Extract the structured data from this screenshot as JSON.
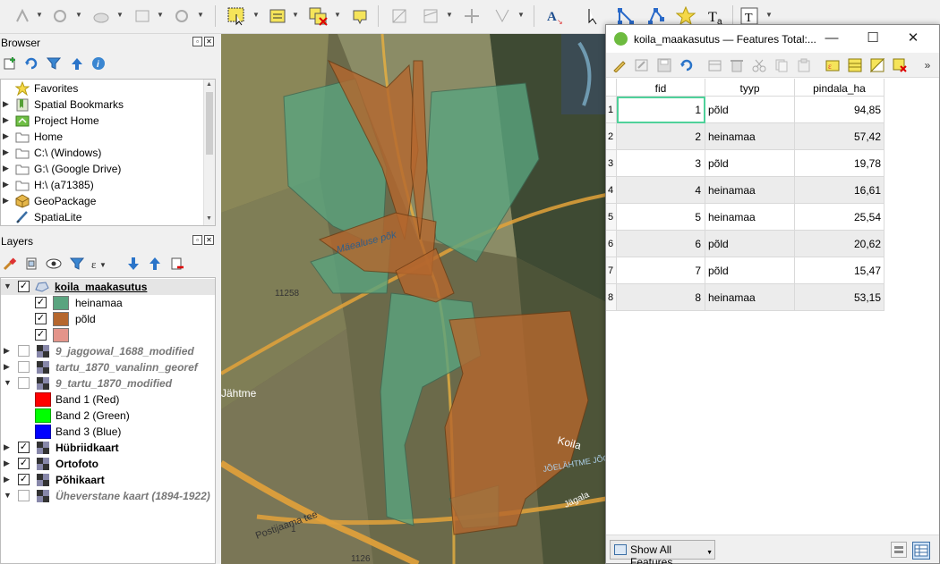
{
  "browser": {
    "title": "Browser",
    "items": [
      {
        "label": "Favorites",
        "icon": "star-icon",
        "expandable": false
      },
      {
        "label": "Spatial Bookmarks",
        "icon": "bookmark-icon",
        "expandable": true
      },
      {
        "label": "Project Home",
        "icon": "project-home-icon",
        "expandable": true
      },
      {
        "label": "Home",
        "icon": "folder-icon",
        "expandable": true
      },
      {
        "label": "C:\\ (Windows)",
        "icon": "drive-icon",
        "expandable": true
      },
      {
        "label": "G:\\ (Google Drive)",
        "icon": "drive-icon",
        "expandable": true
      },
      {
        "label": "H:\\ (a71385)",
        "icon": "drive-icon",
        "expandable": true
      },
      {
        "label": "GeoPackage",
        "icon": "geopackage-icon",
        "expandable": true
      },
      {
        "label": "SpatiaLite",
        "icon": "spatialite-icon",
        "expandable": false
      }
    ]
  },
  "layers": {
    "title": "Layers",
    "koila": {
      "name": "koila_maakasutus"
    },
    "classes": [
      {
        "label": "heinamaa",
        "color": "#5aa47f"
      },
      {
        "label": "põld",
        "color": "#b5672e"
      },
      {
        "label": "",
        "color": "#e3948a"
      }
    ],
    "raster1": "9_jaggowal_1688_modified",
    "raster2": "tartu_1870_vanalinn_georef",
    "raster3": "9_tartu_1870_modified",
    "bands": [
      {
        "label": "Band 1 (Red)",
        "color": "#ff0000"
      },
      {
        "label": "Band 2 (Green)",
        "color": "#00ff00"
      },
      {
        "label": "Band 3 (Blue)",
        "color": "#0000ff"
      }
    ],
    "hybrid": "Hübriidkaart",
    "ortho": "Ortofoto",
    "base": "Põhikaart",
    "old": "Üheverstane kaart (1894-1922)"
  },
  "map": {
    "labels": {
      "road1": "Mäealuse põk",
      "road2": "11258",
      "road3": "Postijaama tee",
      "village1": "Jähtme",
      "village2": "Koila",
      "stream": "JÕELÄHTME JÕGI",
      "road4": "1126",
      "road5": "1",
      "road6": "Jägala"
    }
  },
  "attr_table": {
    "title": "koila_maakasutus — Features Total:...",
    "columns": [
      "fid",
      "tyyp",
      "pindala_ha"
    ],
    "rows": [
      {
        "n": "1",
        "fid": "1",
        "tyyp": "põld",
        "pindala": "94,85"
      },
      {
        "n": "2",
        "fid": "2",
        "tyyp": "heinamaa",
        "pindala": "57,42"
      },
      {
        "n": "3",
        "fid": "3",
        "tyyp": "põld",
        "pindala": "19,78"
      },
      {
        "n": "4",
        "fid": "4",
        "tyyp": "heinamaa",
        "pindala": "16,61"
      },
      {
        "n": "5",
        "fid": "5",
        "tyyp": "heinamaa",
        "pindala": "25,54"
      },
      {
        "n": "6",
        "fid": "6",
        "tyyp": "põld",
        "pindala": "20,62"
      },
      {
        "n": "7",
        "fid": "7",
        "tyyp": "põld",
        "pindala": "15,47"
      },
      {
        "n": "8",
        "fid": "8",
        "tyyp": "heinamaa",
        "pindala": "53,15"
      }
    ],
    "show_all": "Show All Features"
  }
}
